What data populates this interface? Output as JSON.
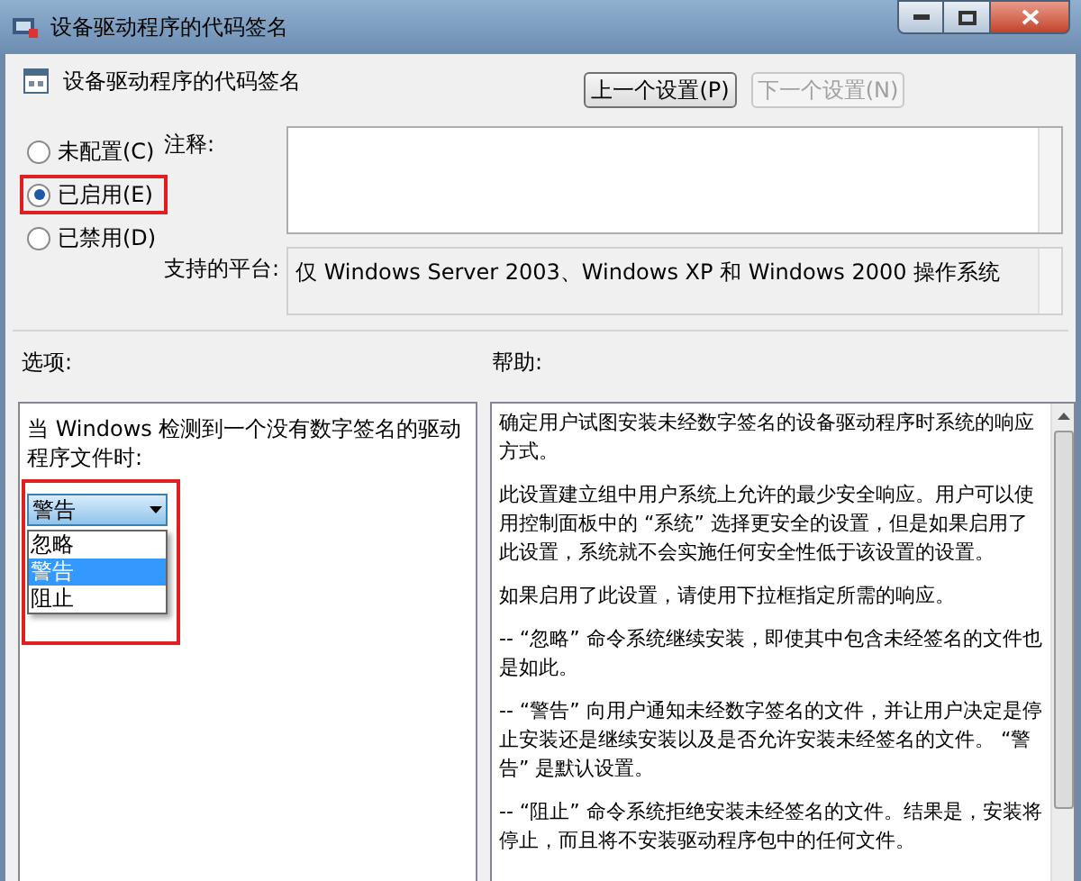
{
  "window": {
    "title": "设备驱动程序的代码签名"
  },
  "header": {
    "title": "设备驱动程序的代码签名"
  },
  "nav_buttons": [
    {
      "label": "上一个设置(P)",
      "disabled": false
    },
    {
      "label": "下一个设置(N)",
      "disabled": true
    }
  ],
  "state_options": [
    {
      "label": "未配置(C)",
      "selected": false
    },
    {
      "label": "已启用(E)",
      "selected": true
    },
    {
      "label": "已禁用(D)",
      "selected": false
    }
  ],
  "comment": {
    "label": "注释:"
  },
  "platform": {
    "label": "支持的平台:",
    "value": "仅 Windows Server 2003、Windows XP 和 Windows 2000 操作系统"
  },
  "options": {
    "heading": "选项:",
    "prompt": "当 Windows 检测到一个没有数字签名的驱动程序文件时:",
    "dropdown": {
      "value": "警告",
      "items": [
        {
          "label": "忽略",
          "selected": false
        },
        {
          "label": "警告",
          "selected": true
        },
        {
          "label": "阻止",
          "selected": false
        }
      ]
    }
  },
  "help": {
    "heading": "帮助:",
    "paragraphs": [
      "确定用户试图安装未经数字签名的设备驱动程序时系统的响应方式。",
      "此设置建立组中用户系统上允许的最少安全响应。用户可以使用控制面板中的 “系统” 选择更安全的设置，但是如果启用了此设置，系统就不会实施任何安全性低于该设置的设置。",
      "如果启用了此设置，请使用下拉框指定所需的响应。",
      "-- “忽略” 命令系统继续安装，即使其中包含未经签名的文件也是如此。",
      "-- “警告” 向用户通知未经数字签名的文件，并让用户决定是停止安装还是继续安装以及是否允许安装未经签名的文件。 “警告” 是默认设置。",
      "-- “阻止” 命令系统拒绝安装未经签名的文件。结果是，安装将停止，而且将不安装驱动程序包中的任何文件。"
    ]
  }
}
